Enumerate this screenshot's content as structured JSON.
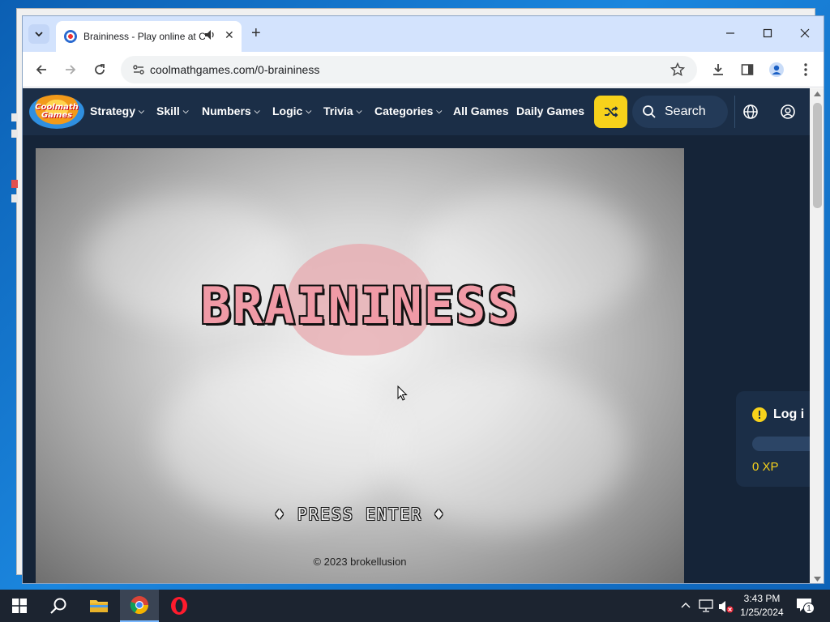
{
  "browser": {
    "tab_title": "Braininess - Play online at C",
    "url": "coolmathgames.com/0-braininess"
  },
  "site": {
    "logo_line1": "Coolmath",
    "logo_line2": "Games",
    "nav": [
      {
        "label": "Strategy",
        "chevron": true
      },
      {
        "label": "Skill",
        "chevron": true
      },
      {
        "label": "Numbers",
        "chevron": true
      },
      {
        "label": "Logic",
        "chevron": true
      },
      {
        "label": "Trivia",
        "chevron": true
      },
      {
        "label": "Categories",
        "chevron": true
      },
      {
        "label": "All Games",
        "chevron": false
      },
      {
        "label": "Daily Games",
        "chevron": false
      }
    ],
    "search_label": "Search",
    "accent_color": "#f7d21b"
  },
  "game": {
    "title": "BRAININESS",
    "prompt": "PRESS ENTER",
    "prompt_ornament": "♦",
    "copyright": "© 2023 brokellusion"
  },
  "xp_panel": {
    "login_label": "Log i",
    "xp": "0 XP"
  },
  "taskbar": {
    "time": "3:43 PM",
    "date": "1/25/2024",
    "notification_count": "1"
  }
}
